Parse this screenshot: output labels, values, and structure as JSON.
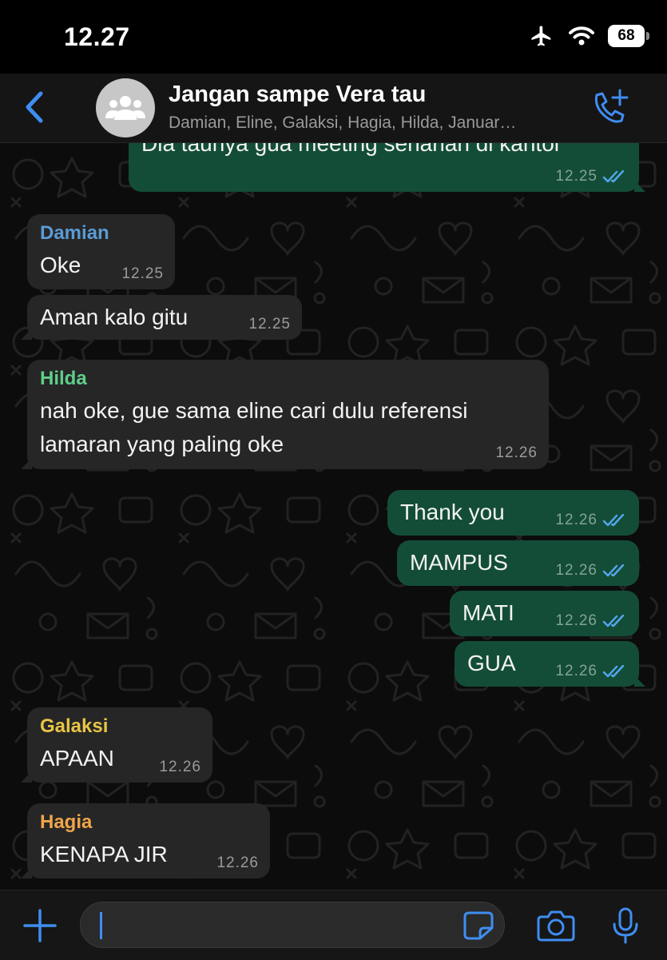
{
  "status_bar": {
    "time": "12.27",
    "battery": "68"
  },
  "header": {
    "title": "Jangan sampe Vera tau",
    "members": "Damian, Eline, Galaksi, Hagia, Hilda, Januar…"
  },
  "messages": [
    {
      "direction": "outgoing",
      "lines": [
        "Dia taunya gua meeting seharian di kantor"
      ],
      "time": "12.25",
      "read": true
    },
    {
      "direction": "incoming",
      "sender": "Damian",
      "sender_color": "#5b9bd5",
      "lines": [
        "Oke"
      ],
      "time": "12.25"
    },
    {
      "direction": "incoming",
      "lines": [
        "Aman kalo gitu"
      ],
      "time": "12.25"
    },
    {
      "direction": "incoming",
      "sender": "Hilda",
      "sender_color": "#5fcf8a",
      "lines": [
        "nah oke, gue sama eline cari dulu referensi",
        "lamaran yang paling oke"
      ],
      "time": "12.26"
    },
    {
      "direction": "outgoing",
      "lines": [
        "Thank you"
      ],
      "time": "12.26",
      "read": true
    },
    {
      "direction": "outgoing",
      "lines": [
        "MAMPUS"
      ],
      "time": "12.26",
      "read": true
    },
    {
      "direction": "outgoing",
      "lines": [
        "MATI"
      ],
      "time": "12.26",
      "read": true
    },
    {
      "direction": "outgoing",
      "lines": [
        "GUA"
      ],
      "time": "12.26",
      "read": true
    },
    {
      "direction": "incoming",
      "sender": "Galaksi",
      "sender_color": "#e8c547",
      "lines": [
        "APAAN"
      ],
      "time": "12.26"
    },
    {
      "direction": "incoming",
      "sender": "Hagia",
      "sender_color": "#f0a54a",
      "lines": [
        "KENAPA JIR"
      ],
      "time": "12.26"
    }
  ],
  "colors": {
    "incoming_bubble": "#262626",
    "outgoing_bubble": "#144d37",
    "accent": "#3f8df2",
    "read_ticks": "#53a8f0"
  },
  "icons": {
    "back": "chevron-left-icon",
    "group_avatar": "group-icon",
    "add_call": "phone-plus-icon",
    "attach": "plus-icon",
    "sticker": "sticker-icon",
    "camera": "camera-icon",
    "mic": "microphone-icon"
  }
}
